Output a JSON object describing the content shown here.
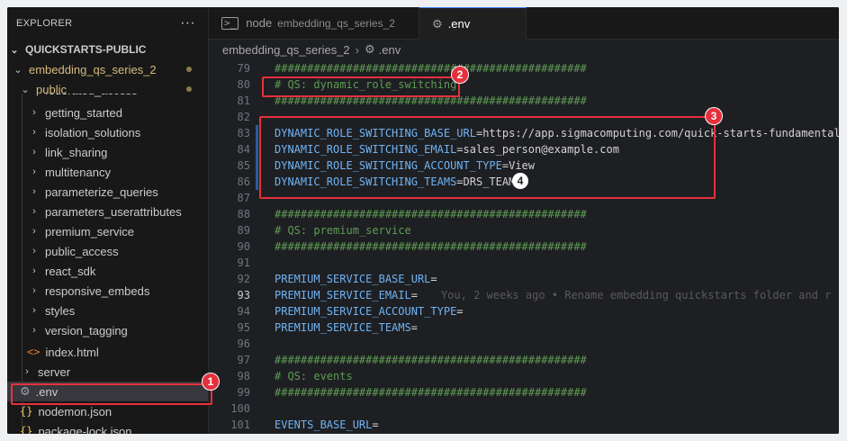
{
  "explorer": {
    "title": "EXPLORER",
    "more_label": "···",
    "root": "QUICKSTARTS-PUBLIC",
    "folder": "embedding_qs_series_2",
    "subfolder": "public",
    "clipped_item": "federated_access",
    "items": [
      "getting_started",
      "isolation_solutions",
      "link_sharing",
      "multitenancy",
      "parameterize_queries",
      "parameters_userattributes",
      "premium_service",
      "public_access",
      "react_sdk",
      "responsive_embeds",
      "styles",
      "version_tagging"
    ],
    "index_file": "index.html",
    "server_folder": "server",
    "env_file": ".env",
    "nodemon_file": "nodemon.json",
    "package_lock_file": "package-lock.json"
  },
  "tabs": [
    {
      "label": "node",
      "sublabel": "embedding_qs_series_2"
    },
    {
      "label": ".env"
    }
  ],
  "breadcrumb": {
    "folder": "embedding_qs_series_2",
    "file": ".env"
  },
  "code": {
    "sep": "################################################",
    "lines": [
      {
        "n": "79",
        "t": "################################################"
      },
      {
        "n": "80",
        "t": "# QS: dynamic_role_switching"
      },
      {
        "n": "81",
        "t": "################################################"
      },
      {
        "n": "82",
        "t": ""
      },
      {
        "n": "83",
        "k": "DYNAMIC_ROLE_SWITCHING_BASE_URL",
        "v": "https://app.sigmacomputing.com/quick-starts-fundamentals"
      },
      {
        "n": "84",
        "k": "DYNAMIC_ROLE_SWITCHING_EMAIL",
        "v": "sales_person@example.com"
      },
      {
        "n": "85",
        "k": "DYNAMIC_ROLE_SWITCHING_ACCOUNT_TYPE",
        "v": "View"
      },
      {
        "n": "86",
        "k": "DYNAMIC_ROLE_SWITCHING_TEAMS",
        "v": "DRS_TEAM"
      },
      {
        "n": "87",
        "t": ""
      },
      {
        "n": "88",
        "t": "################################################"
      },
      {
        "n": "89",
        "t": "# QS: premium_service"
      },
      {
        "n": "90",
        "t": "################################################"
      },
      {
        "n": "91",
        "t": ""
      },
      {
        "n": "92",
        "k": "PREMIUM_SERVICE_BASE_URL",
        "v": ""
      },
      {
        "n": "93",
        "k": "PREMIUM_SERVICE_EMAIL",
        "v": "",
        "blame": "You, 2 weeks ago • Rename embedding quickstarts folder and r"
      },
      {
        "n": "94",
        "k": "PREMIUM_SERVICE_ACCOUNT_TYPE",
        "v": ""
      },
      {
        "n": "95",
        "k": "PREMIUM_SERVICE_TEAMS",
        "v": ""
      },
      {
        "n": "96",
        "t": ""
      },
      {
        "n": "97",
        "t": "################################################"
      },
      {
        "n": "98",
        "t": "# QS: events"
      },
      {
        "n": "99",
        "t": "################################################"
      },
      {
        "n": "100",
        "t": ""
      },
      {
        "n": "101",
        "k": "EVENTS_BASE_URL",
        "v": ""
      }
    ]
  },
  "annotations": [
    "1",
    "2",
    "3",
    "4"
  ]
}
